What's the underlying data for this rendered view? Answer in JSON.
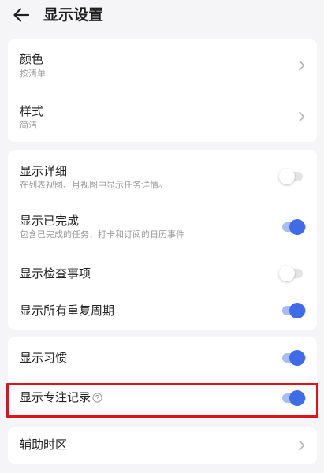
{
  "header": {
    "title": "显示设置"
  },
  "card1": [
    {
      "title": "颜色",
      "subtitle": "按清单"
    },
    {
      "title": "样式",
      "subtitle": "简洁"
    }
  ],
  "card2": [
    {
      "title": "显示详细",
      "subtitle": "在列表视图、月视图中显示任务详情。",
      "on": false
    },
    {
      "title": "显示已完成",
      "subtitle": "包含已完成的任务、打卡和订阅的日历事件",
      "on": true
    },
    {
      "title": "显示检查事项",
      "on": false
    },
    {
      "title": "显示所有重复周期",
      "on": true
    }
  ],
  "card3": [
    {
      "title": "显示习惯",
      "on": true
    },
    {
      "title": "显示专注记录",
      "on": true
    }
  ],
  "card4": [
    {
      "title": "辅助时区"
    }
  ],
  "colors": {
    "accent": "#3f6ae8",
    "accent_track": "#a9bdf3",
    "highlight": "#e0121e",
    "background": "#f5f5f7"
  }
}
